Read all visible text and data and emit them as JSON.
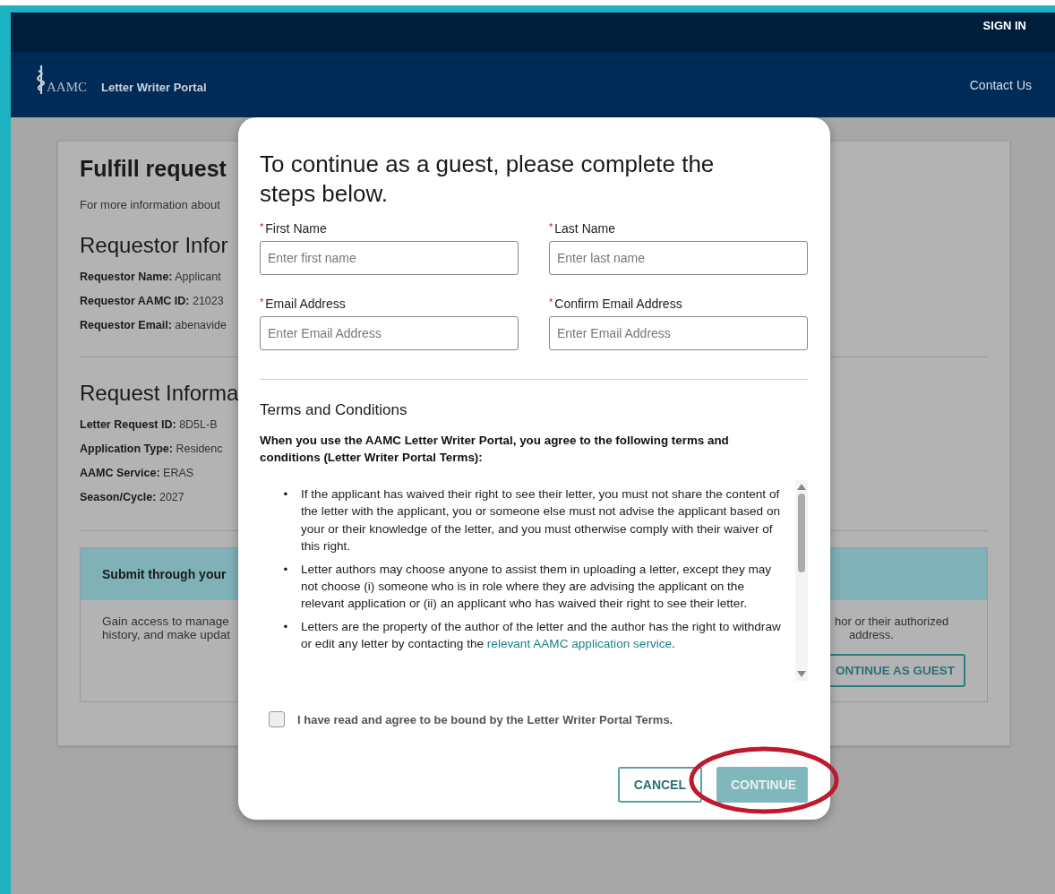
{
  "header": {
    "sign_in": "SIGN IN",
    "logo_text": "AAMC",
    "portal_name": "Letter Writer Portal",
    "contact_link": "Contact Us"
  },
  "page": {
    "title": "Fulfill request",
    "intro": "For more information about",
    "sections": [
      {
        "heading": "Requestor Infor",
        "rows": [
          {
            "label": "Requestor Name:",
            "value": "Applicant"
          },
          {
            "label": "Requestor AAMC ID:",
            "value": "21023"
          },
          {
            "label": "Requestor Email:",
            "value": "abenavide"
          }
        ]
      },
      {
        "heading": "Request Informa",
        "rows": [
          {
            "label": "Letter Request ID:",
            "value": "8D5L-B"
          },
          {
            "label": "Application Type:",
            "value": "Residenc"
          },
          {
            "label": "AAMC Service:",
            "value": "ERAS"
          },
          {
            "label": "Season/Cycle:",
            "value": "2027"
          }
        ]
      }
    ],
    "submit_box": {
      "heading": "Submit through your",
      "left_lines": [
        "Gain access to manage",
        "history, and make updat"
      ],
      "right_lines": [
        "hor or their authorized",
        "address."
      ],
      "guest_button": "ONTINUE AS GUEST"
    }
  },
  "modal": {
    "title": "To continue as a guest, please complete the steps below.",
    "fields": [
      {
        "label": "First Name",
        "required": true,
        "placeholder": "Enter first name"
      },
      {
        "label": "Last Name",
        "required": true,
        "placeholder": "Enter last name"
      },
      {
        "label": "Email Address",
        "required": true,
        "placeholder": "Enter Email Address"
      },
      {
        "label": "Confirm Email Address",
        "required": true,
        "placeholder": "Enter Email Address"
      }
    ],
    "required_marker": "*",
    "bullet": "•",
    "terms_heading": "Terms and Conditions",
    "terms_intro": "When you use the AAMC Letter Writer Portal, you agree to the following terms and conditions (Letter Writer Portal Terms):",
    "terms": [
      {
        "text": "If the applicant has waived their right to see their letter, you must not share the content of the letter with the applicant, you or someone else must not advise the applicant based on your or their knowledge of the letter, and you must otherwise comply with their waiver of this right."
      },
      {
        "text": "Letter authors may choose anyone to assist them in uploading a letter, except they may not choose (i) someone who is in role where they are advising the applicant on the relevant application or (ii) an applicant who has waived their right to see their letter."
      },
      {
        "text": "Letters are the property of the author of the letter and the author has the right to withdraw or edit any letter by contacting the",
        "link": "relevant AAMC application service",
        "after": "."
      }
    ],
    "agree": {
      "label": "I have read and agree to be bound by the Letter Writer Portal Terms.",
      "checked": false
    },
    "buttons": [
      {
        "label": "CANCEL",
        "kind": "outline",
        "disabled": false
      },
      {
        "label": "CONTINUE",
        "kind": "primary",
        "disabled": true
      }
    ]
  }
}
